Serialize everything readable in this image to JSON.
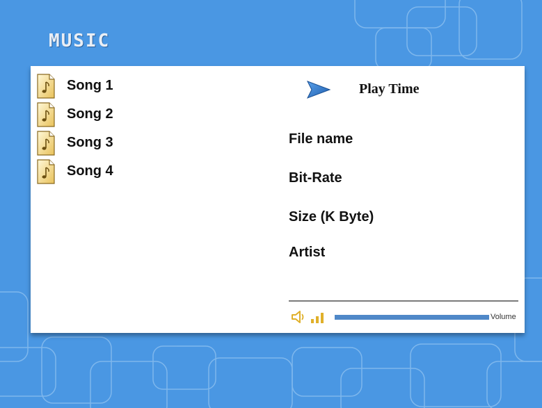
{
  "app": {
    "title": "MUSIC"
  },
  "songs": [
    {
      "label": "Song 1",
      "icon": "music-file-icon"
    },
    {
      "label": "Song 2",
      "icon": "music-file-icon"
    },
    {
      "label": "Song 3",
      "icon": "music-file-icon"
    },
    {
      "label": "Song 4",
      "icon": "music-file-icon"
    }
  ],
  "player": {
    "play_icon": "play-icon",
    "play_time_label": "Play Time"
  },
  "info": {
    "file_name_label": "File name",
    "bit_rate_label": "Bit-Rate",
    "size_label": "Size (K Byte)",
    "artist_label": "Artist"
  },
  "volume": {
    "label": "Volume",
    "level_percent": 100,
    "speaker_icon": "speaker-icon",
    "level_icon": "signal-bars-icon"
  },
  "colors": {
    "background": "#4a97e3",
    "panel": "#ffffff",
    "accent": "#2f6fbd",
    "icon_gold": "#e0b02a",
    "volume_bar": "#4f88c8"
  }
}
